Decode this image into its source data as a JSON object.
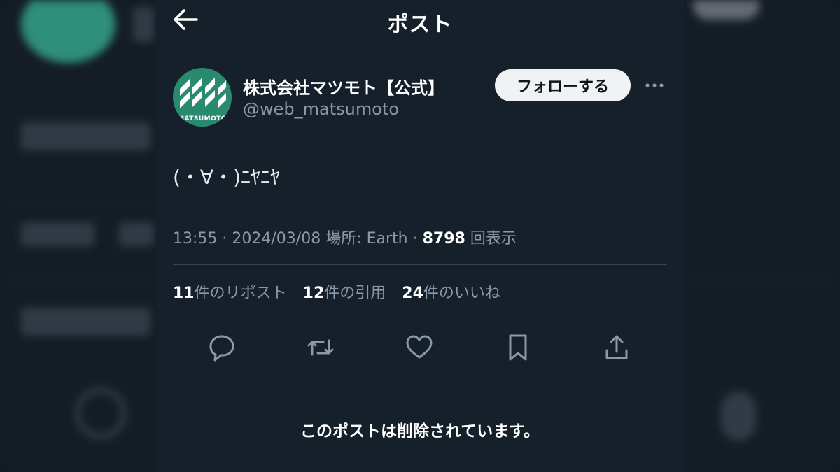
{
  "header": {
    "title": "ポスト",
    "back_icon": "arrow-left-icon"
  },
  "author": {
    "display_name": "株式会社マツモト【公式】",
    "handle": "@web_matsumoto",
    "avatar_brand_text": "MATSUMOTO",
    "avatar_color": "#2a8a6f"
  },
  "follow_button": {
    "label": "フォローする"
  },
  "post": {
    "text": "(・∀・)ﾆﾔﾆﾔ",
    "time": "13:55",
    "date": "2024/03/08",
    "location_label": "場所: Earth",
    "views_count": "8798",
    "views_suffix": "回表示"
  },
  "stats": {
    "reposts_count": "11",
    "reposts_label": "件のリポスト",
    "quotes_count": "12",
    "quotes_label": "件の引用",
    "likes_count": "24",
    "likes_label": "件のいいね"
  },
  "actions": [
    "reply-icon",
    "repost-icon",
    "like-icon",
    "bookmark-icon",
    "share-icon"
  ],
  "deleted_notice": "このポストは削除されています。",
  "colors": {
    "panel_bg": "#15202b",
    "muted_text": "#8b98a5",
    "divider": "#38444d",
    "follow_bg": "#eff3f4"
  }
}
